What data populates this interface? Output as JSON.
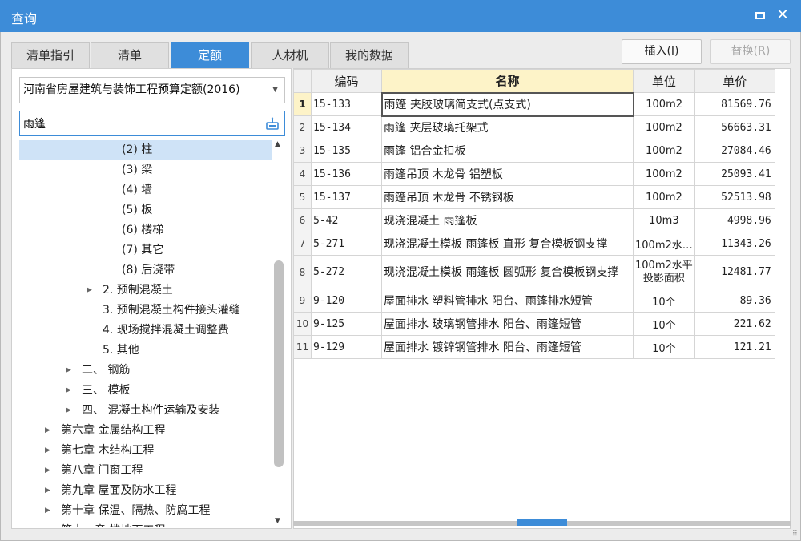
{
  "window": {
    "title": "查询"
  },
  "tabs": [
    {
      "label": "清单指引"
    },
    {
      "label": "清单"
    },
    {
      "label": "定额"
    },
    {
      "label": "人材机"
    },
    {
      "label": "我的数据"
    }
  ],
  "active_tab": "定额",
  "buttons": {
    "insert": "插入(I)",
    "replace": "替换(R)"
  },
  "library_select": {
    "value": "河南省房屋建筑与装饰工程预算定额(2016)"
  },
  "search": {
    "value": "雨篷"
  },
  "tree": [
    {
      "label": "(2) 柱",
      "selected": true
    },
    {
      "label": "(3) 梁"
    },
    {
      "label": "(4) 墙"
    },
    {
      "label": "(5) 板"
    },
    {
      "label": "(6) 楼梯"
    },
    {
      "label": "(7) 其它"
    },
    {
      "label": "(8) 后浇带"
    },
    {
      "label": "2. 预制混凝土",
      "expandable": true
    },
    {
      "label": "3. 预制混凝土构件接头灌缝"
    },
    {
      "label": "4. 现场搅拌混凝土调整费"
    },
    {
      "label": "5. 其他"
    },
    {
      "label": "二、 钢筋",
      "expandable": true
    },
    {
      "label": "三、 模板",
      "expandable": true
    },
    {
      "label": "四、 混凝土构件运输及安装",
      "expandable": true
    },
    {
      "label": "第六章 金属结构工程",
      "expandable": true
    },
    {
      "label": "第七章 木结构工程",
      "expandable": true
    },
    {
      "label": "第八章 门窗工程",
      "expandable": true
    },
    {
      "label": "第九章 屋面及防水工程",
      "expandable": true
    },
    {
      "label": "第十章 保温、隔热、防腐工程",
      "expandable": true
    },
    {
      "label": "第十一章 楼地面工程",
      "expandable": true
    }
  ],
  "table": {
    "headers": {
      "code": "编码",
      "name": "名称",
      "unit": "单位",
      "price": "单价"
    },
    "rows": [
      {
        "no": "1",
        "code": "15-133",
        "name": "雨篷 夹胶玻璃简支式(点支式)",
        "unit": "100m2",
        "price": "81569.76"
      },
      {
        "no": "2",
        "code": "15-134",
        "name": "雨篷 夹层玻璃托架式",
        "unit": "100m2",
        "price": "56663.31"
      },
      {
        "no": "3",
        "code": "15-135",
        "name": "雨篷 铝合金扣板",
        "unit": "100m2",
        "price": "27084.46"
      },
      {
        "no": "4",
        "code": "15-136",
        "name": "雨篷吊顶 木龙骨 铝塑板",
        "unit": "100m2",
        "price": "25093.41"
      },
      {
        "no": "5",
        "code": "15-137",
        "name": "雨篷吊顶 木龙骨 不锈钢板",
        "unit": "100m2",
        "price": "52513.98"
      },
      {
        "no": "6",
        "code": "5-42",
        "name": "现浇混凝土 雨篷板",
        "unit": "10m3",
        "price": "4998.96"
      },
      {
        "no": "7",
        "code": "5-271",
        "name": "现浇混凝土模板 雨篷板 直形 复合模板钢支撑",
        "unit": "100m2水…",
        "price": "11343.26"
      },
      {
        "no": "8",
        "code": "5-272",
        "name": "现浇混凝土模板 雨篷板 圆弧形 复合模板钢支撑",
        "unit": "100m2水平投影面积",
        "price": "12481.77"
      },
      {
        "no": "9",
        "code": "9-120",
        "name": "屋面排水 塑料管排水 阳台、雨篷排水短管",
        "unit": "10个",
        "price": "89.36"
      },
      {
        "no": "10",
        "code": "9-125",
        "name": "屋面排水 玻璃钢管排水 阳台、雨篷短管",
        "unit": "10个",
        "price": "221.62"
      },
      {
        "no": "11",
        "code": "9-129",
        "name": "屋面排水 镀锌钢管排水 阳台、雨篷短管",
        "unit": "10个",
        "price": "121.21"
      }
    ]
  },
  "colors": {
    "accent": "#3d8cd8",
    "selected_row": "#cfe3f7",
    "header_highlight": "#fdf3c8"
  }
}
